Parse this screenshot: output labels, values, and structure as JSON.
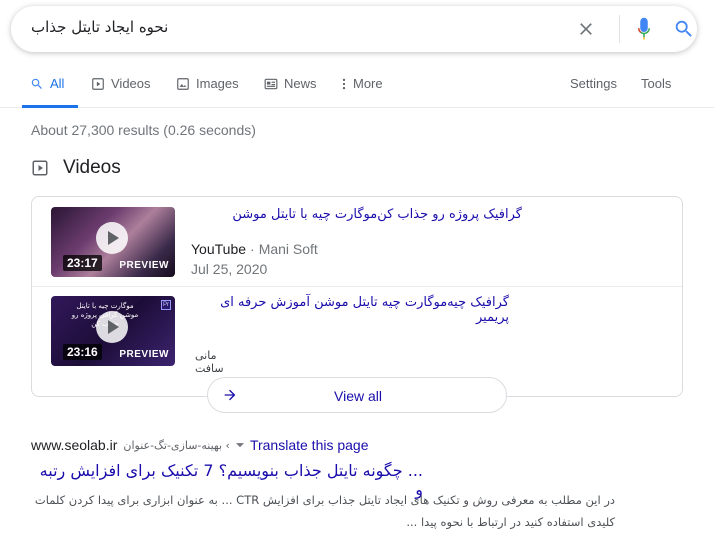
{
  "search": {
    "query": "نحوه ایجاد تایتل جذاب"
  },
  "tabs": [
    {
      "label": "All",
      "active": true
    },
    {
      "label": "Videos"
    },
    {
      "label": "Images"
    },
    {
      "label": "News"
    },
    {
      "label": "More"
    }
  ],
  "tools": {
    "settings": "Settings",
    "tools": "Tools"
  },
  "result_stats": "About 27,300 results (0.26 seconds)",
  "videos": {
    "header": "Videos",
    "items": [
      {
        "title": "گرافیک پروژه رو جذاب کن‌موگارت چیه با تایتل موشن",
        "duration": "23:17",
        "preview": "PREVIEW",
        "source": "YouTube",
        "channel": "Mani Soft",
        "date": "Jul 25, 2020"
      },
      {
        "title": "گرافیک چیه‌موگارت چیه تایتل موشن آموزش حرفه ای پریمیر",
        "duration": "23:16",
        "preview": "PREVIEW",
        "channel": "مانی سافت",
        "thumb_text": "موگارت چیه با تایتل موشن گرافی پروژه رو جذاب کن",
        "badge": "Pr"
      }
    ],
    "view_all": "View all"
  },
  "result": {
    "domain": "www.seolab.ir",
    "breadcrumb": "› بهینه-سازی-تگ-عنوان",
    "translate": "Translate this page",
    "title": "... چگونه تایتل جذاب بنویسیم؟ 7 تکنیک برای افزایش رتبه و",
    "snippet_1": "در این مطلب به معرفی روش و تکنیک های ایجاد تایتل جذاب برای افزایش CTR ... به عنوان ابزاری برای پیدا کردن کلمات",
    "snippet_2": "کلیدی استفاده کنید در ارتباط با نحوه پیدا ..."
  },
  "colors": {
    "link": "#1a0dab",
    "accent": "#1a73e8",
    "meta": "#70757a"
  }
}
